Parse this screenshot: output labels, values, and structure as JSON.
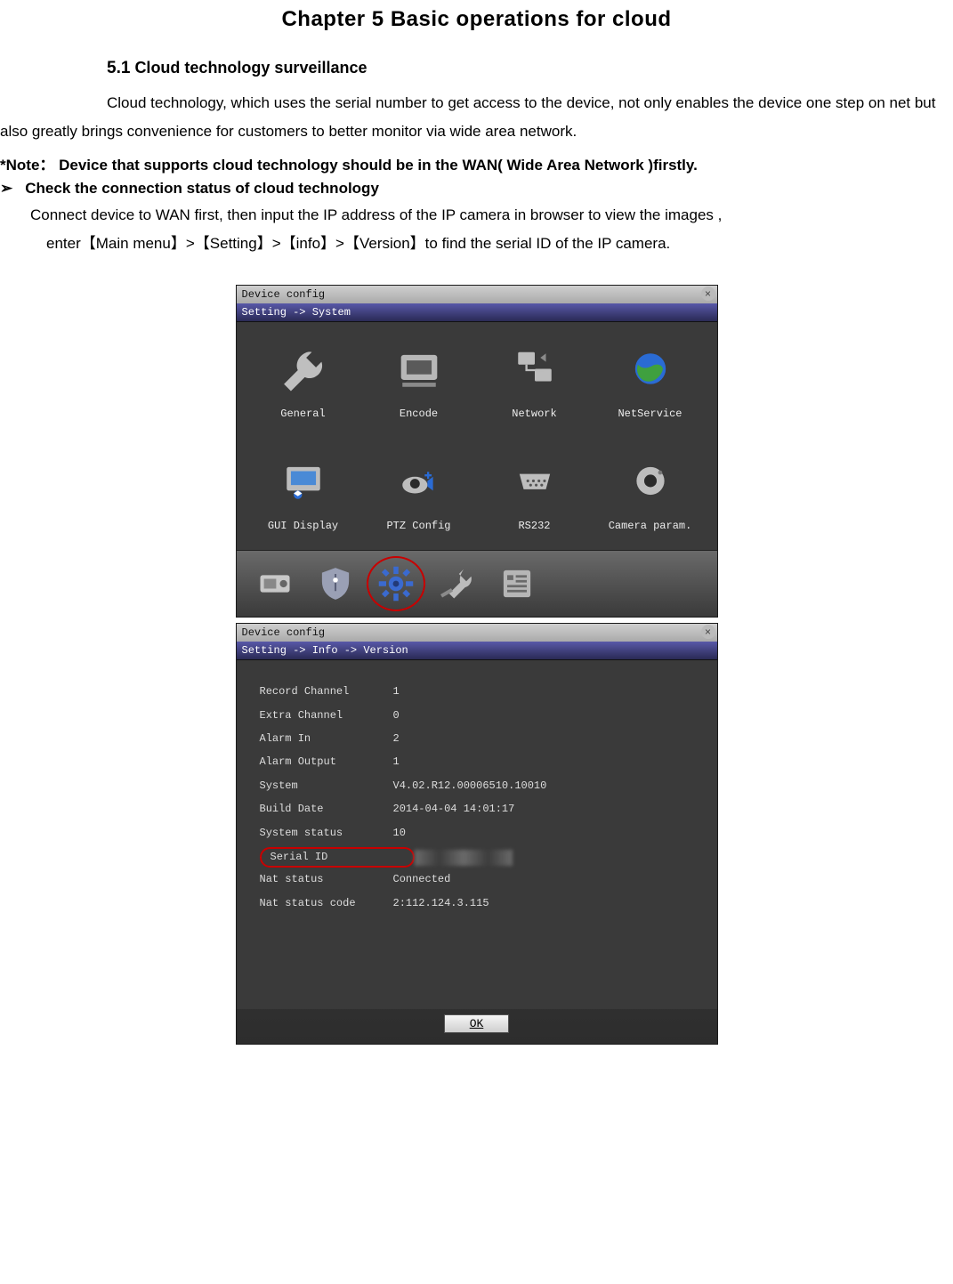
{
  "chapter_title": "Chapter 5    Basic operations for cloud",
  "section": {
    "number": "5.1",
    "title": "Cloud technology surveillance"
  },
  "paragraph": "Cloud technology, which uses the serial number to get access to the device, not only enables the device one step on net but also greatly brings convenience for customers to better monitor via wide area network.",
  "note": "*Note：  Device that supports cloud technology should be in the WAN( Wide Area Network )firstly.",
  "bullet": "Check the connection status of cloud technology",
  "connect_text": "Connect device to WAN first, then input the IP address of the IP camera in browser to view the images ,",
  "enter_text": "enter【Main menu】>【Setting】>【info】>【Version】to find the serial ID of the IP camera.",
  "win1": {
    "title": "Device config",
    "breadcrumb": "Setting -> System",
    "items": [
      "General",
      "Encode",
      "Network",
      "NetService",
      "GUI Display",
      "PTZ Config",
      "RS232",
      "Camera param."
    ]
  },
  "win2": {
    "title": "Device config",
    "breadcrumb": "Setting -> Info -> Version",
    "rows": [
      {
        "k": "Record Channel",
        "v": "1"
      },
      {
        "k": "Extra Channel",
        "v": "0"
      },
      {
        "k": "Alarm In",
        "v": "2"
      },
      {
        "k": "Alarm Output",
        "v": "1"
      },
      {
        "k": "System",
        "v": "V4.02.R12.00006510.10010"
      },
      {
        "k": "Build Date",
        "v": "2014-04-04 14:01:17"
      },
      {
        "k": "System status",
        "v": "10"
      },
      {
        "k": "Serial ID",
        "v": "",
        "highlight": true,
        "blur": true
      },
      {
        "k": "Nat status",
        "v": "Connected"
      },
      {
        "k": "Nat status code",
        "v": "2:112.124.3.115"
      }
    ],
    "ok": "OK"
  }
}
